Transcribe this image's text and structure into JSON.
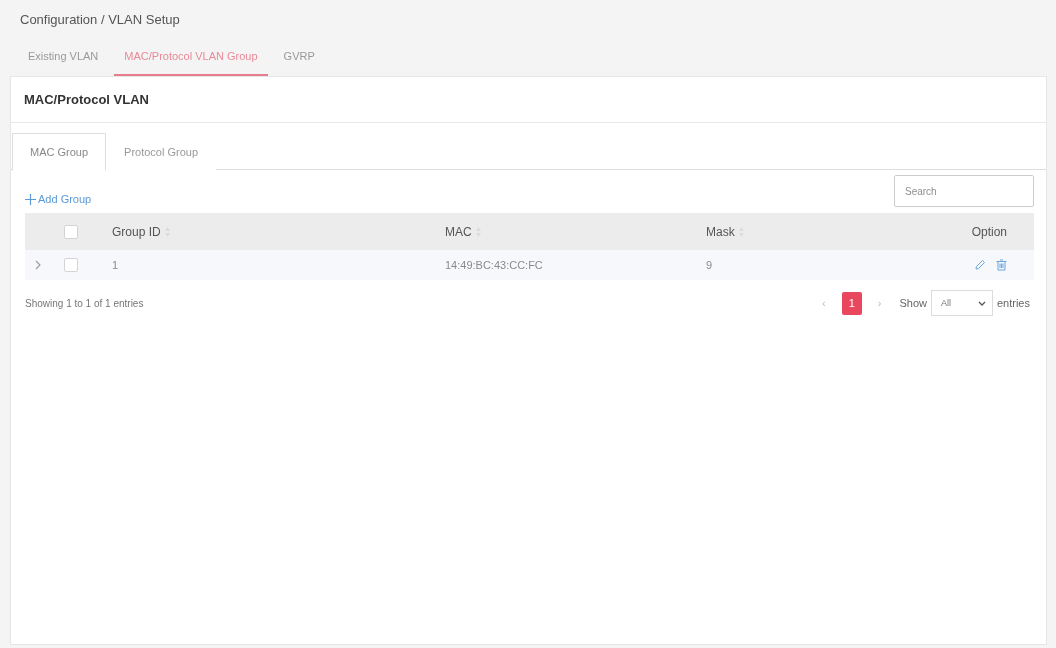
{
  "breadcrumb": "Configuration / VLAN Setup",
  "tabs": [
    {
      "label": "Existing VLAN",
      "selected": false
    },
    {
      "label": "MAC/Protocol VLAN Group",
      "selected": true
    },
    {
      "label": "GVRP",
      "selected": false
    }
  ],
  "panel": {
    "title": "MAC/Protocol VLAN",
    "subtabs": [
      {
        "label": "MAC Group",
        "selected": true
      },
      {
        "label": "Protocol Group",
        "selected": false
      }
    ],
    "add_button": {
      "label": "Add Group"
    },
    "search": {
      "placeholder": "Search"
    }
  },
  "table": {
    "header_checked": false,
    "columns": [
      {
        "label": "Group ID",
        "sortable": true
      },
      {
        "label": "MAC",
        "sortable": true
      },
      {
        "label": "Mask",
        "sortable": true
      },
      {
        "label": "Option",
        "sortable": false
      }
    ],
    "rows": [
      {
        "expanded": false,
        "checked": false,
        "cells": [
          "1",
          "14:49:BC:43:CC:FC",
          "9"
        ]
      }
    ]
  },
  "footer": {
    "info": "Showing 1 to 1 of 1 entries",
    "pagination": {
      "prev": "‹",
      "pages": [
        {
          "label": "1",
          "selected": true
        }
      ],
      "next": "›"
    },
    "page_size": {
      "label_before": "Show",
      "value": "All",
      "label_after": "entries"
    }
  }
}
